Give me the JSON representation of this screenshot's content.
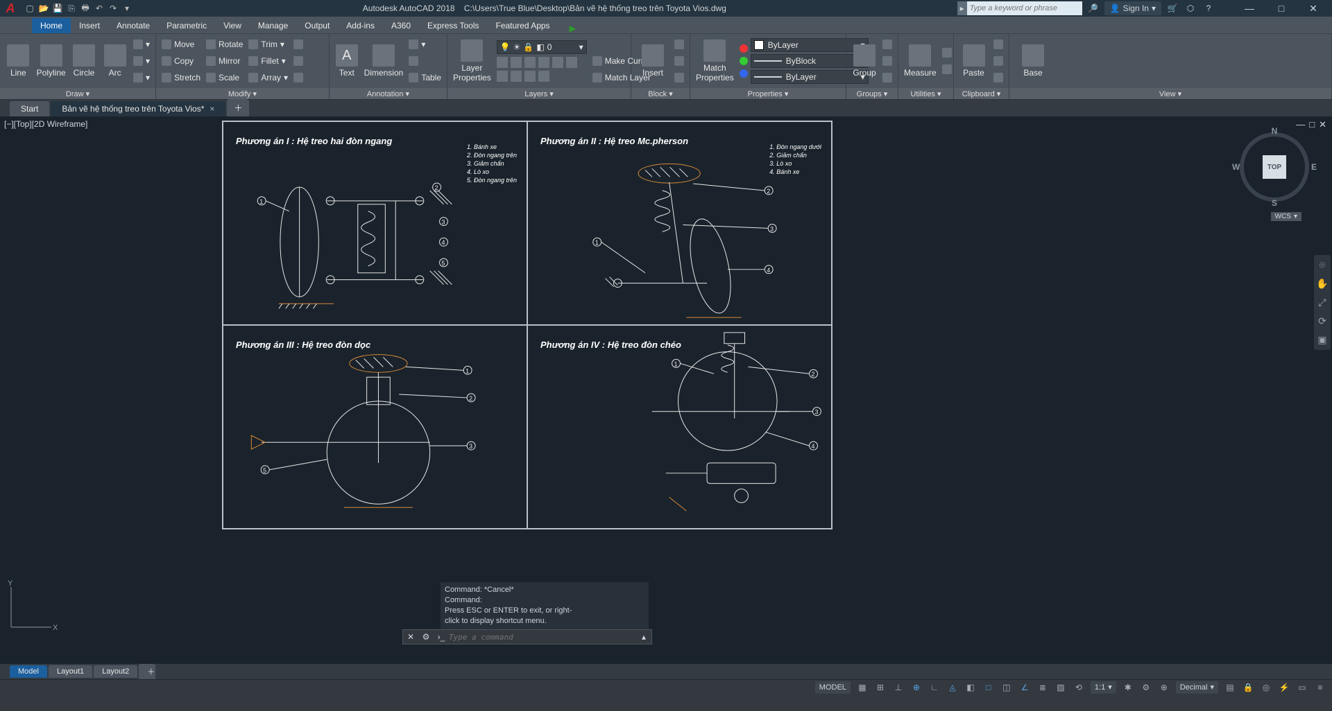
{
  "app": {
    "name": "Autodesk AutoCAD 2018",
    "file_path": "C:\\Users\\True Blue\\Desktop\\Bản vẽ hệ thống treo trên Toyota Vios.dwg",
    "search_placeholder": "Type a keyword or phrase",
    "sign_in": "Sign In"
  },
  "qat": [
    "new",
    "open",
    "save",
    "saveas",
    "plot",
    "undo",
    "redo"
  ],
  "ribbon_tabs": [
    "Home",
    "Insert",
    "Annotate",
    "Parametric",
    "View",
    "Manage",
    "Output",
    "Add-ins",
    "A360",
    "Express Tools",
    "Featured Apps"
  ],
  "active_ribbon_tab": "Home",
  "panels": {
    "draw": {
      "title": "Draw ▾",
      "items": [
        "Line",
        "Polyline",
        "Circle",
        "Arc"
      ]
    },
    "modify": {
      "title": "Modify ▾",
      "col1": [
        "Move",
        "Copy",
        "Stretch"
      ],
      "col2": [
        "Rotate",
        "Mirror",
        "Scale"
      ],
      "col3": [
        "Trim",
        "Fillet",
        "Array"
      ]
    },
    "annotation": {
      "title": "Annotation ▾",
      "items": [
        "Text",
        "Dimension"
      ],
      "extra": "Table"
    },
    "layers": {
      "title": "Layers ▾",
      "big": "Layer\nProperties",
      "current": "0",
      "rows": [
        "Make Current",
        "Match Layer"
      ]
    },
    "block": {
      "title": "Block ▾",
      "big": "Insert"
    },
    "properties": {
      "title": "Properties ▾",
      "big": "Match\nProperties",
      "combos": [
        "ByLayer",
        "ByBlock",
        "ByLayer"
      ]
    },
    "groups": {
      "title": "Groups ▾",
      "big": "Group"
    },
    "utilities": {
      "title": "Utilities ▾",
      "big": "Measure"
    },
    "clipboard": {
      "title": "Clipboard ▾",
      "big": "Paste"
    },
    "view": {
      "title": "View ▾",
      "big": "Base"
    }
  },
  "file_tabs": {
    "start": "Start",
    "doc": "Bản vẽ hệ thống treo trên Toyota Vios*"
  },
  "viewport": {
    "label": "[−][Top][2D Wireframe]",
    "viewcube_face": "TOP",
    "wcs": "WCS",
    "ucs": {
      "x": "X",
      "y": "Y"
    }
  },
  "drawing": {
    "cells": [
      {
        "title": "Phương án I : Hệ treo hai đòn ngang",
        "legend": [
          "1. Bánh xe",
          "2. Đòn ngang trên",
          "3. Giảm chấn",
          "4. Lò xo",
          "5. Đòn ngang trên"
        ]
      },
      {
        "title": "Phương án II : Hệ treo Mc.pherson",
        "legend": [
          "1. Đòn ngang dưới",
          "2. Giảm chấn",
          "3. Lò xo",
          "4. Bánh xe"
        ]
      },
      {
        "title": "Phương án III : Hệ treo đòn dọc",
        "legend": []
      },
      {
        "title": "Phương án IV : Hệ treo đòn chéo",
        "legend": []
      }
    ]
  },
  "command": {
    "history": [
      "Command: *Cancel*",
      "Command:",
      "Press ESC or ENTER to exit, or right-",
      "click to display shortcut menu."
    ],
    "placeholder": "Type a command"
  },
  "bottom_tabs": [
    "Model",
    "Layout1",
    "Layout2"
  ],
  "status": {
    "model": "MODEL",
    "scale": "1:1",
    "decimal": "Decimal"
  }
}
